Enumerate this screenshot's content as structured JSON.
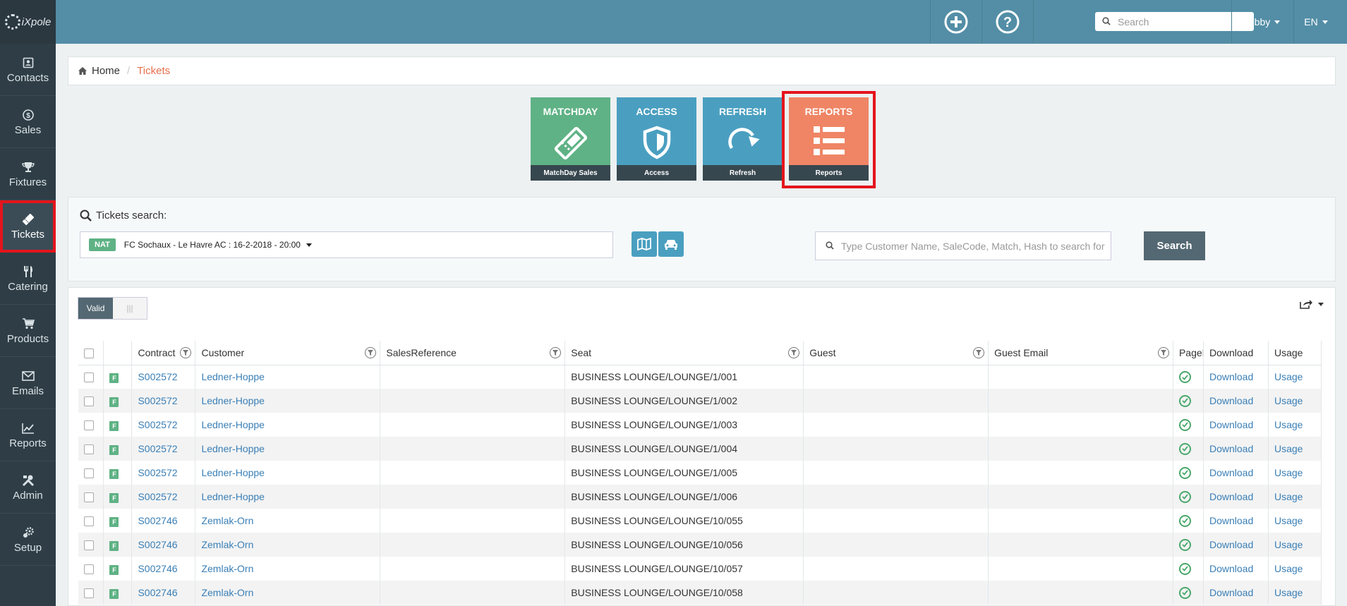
{
  "app": {
    "logo_text": "iXpole"
  },
  "sidebar": {
    "items": [
      {
        "label": "Contacts",
        "icon": "contacts-icon"
      },
      {
        "label": "Sales",
        "icon": "dollar-icon"
      },
      {
        "label": "Fixtures",
        "icon": "trophy-icon"
      },
      {
        "label": "Tickets",
        "icon": "ticket-icon",
        "active": true
      },
      {
        "label": "Catering",
        "icon": "cutlery-icon"
      },
      {
        "label": "Products",
        "icon": "cart-icon"
      },
      {
        "label": "Emails",
        "icon": "envelope-icon"
      },
      {
        "label": "Reports",
        "icon": "chart-icon"
      },
      {
        "label": "Admin",
        "icon": "tools-icon"
      },
      {
        "label": "Setup",
        "icon": "gears-icon"
      }
    ]
  },
  "topbar": {
    "search_placeholder": "Search",
    "user": "Robby",
    "lang": "EN"
  },
  "breadcrumb": {
    "home": "Home",
    "current": "Tickets"
  },
  "tiles": [
    {
      "title": "MATCHDAY",
      "footer": "MatchDay Sales",
      "color": "#5fb285",
      "icon": "ticket-icon"
    },
    {
      "title": "ACCESS",
      "footer": "Access",
      "color": "#4a9fc0",
      "icon": "shield-icon"
    },
    {
      "title": "REFRESH",
      "footer": "Refresh",
      "color": "#4a9fc0",
      "icon": "refresh-icon"
    },
    {
      "title": "REPORTS",
      "footer": "Reports",
      "color": "#ef8565",
      "icon": "list-icon"
    }
  ],
  "search_panel": {
    "title": "Tickets search:",
    "badge": "NAT",
    "selected_match": "FC Sochaux - Le Havre AC : 16-2-2018 - 20:00",
    "free_search_placeholder": "Type Customer Name, SaleCode, Match, Hash to search for",
    "search_button": "Search"
  },
  "table_panel": {
    "toggle_on": "Valid",
    "toggle_off": "|||",
    "columns": [
      "Contract",
      "Customer",
      "SalesReference",
      "Seat",
      "Guest",
      "Guest Email",
      "PageF",
      "Download",
      "Usage"
    ],
    "badge": "F",
    "rows": [
      {
        "contract": "S002572",
        "customer": "Ledner-Hoppe",
        "seat": "BUSINESS LOUNGE/LOUNGE/1/001",
        "download": "Download",
        "usage": "Usage"
      },
      {
        "contract": "S002572",
        "customer": "Ledner-Hoppe",
        "seat": "BUSINESS LOUNGE/LOUNGE/1/002",
        "download": "Download",
        "usage": "Usage"
      },
      {
        "contract": "S002572",
        "customer": "Ledner-Hoppe",
        "seat": "BUSINESS LOUNGE/LOUNGE/1/003",
        "download": "Download",
        "usage": "Usage"
      },
      {
        "contract": "S002572",
        "customer": "Ledner-Hoppe",
        "seat": "BUSINESS LOUNGE/LOUNGE/1/004",
        "download": "Download",
        "usage": "Usage"
      },
      {
        "contract": "S002572",
        "customer": "Ledner-Hoppe",
        "seat": "BUSINESS LOUNGE/LOUNGE/1/005",
        "download": "Download",
        "usage": "Usage"
      },
      {
        "contract": "S002572",
        "customer": "Ledner-Hoppe",
        "seat": "BUSINESS LOUNGE/LOUNGE/1/006",
        "download": "Download",
        "usage": "Usage"
      },
      {
        "contract": "S002746",
        "customer": "Zemlak-Orn",
        "seat": "BUSINESS LOUNGE/LOUNGE/10/055",
        "download": "Download",
        "usage": "Usage"
      },
      {
        "contract": "S002746",
        "customer": "Zemlak-Orn",
        "seat": "BUSINESS LOUNGE/LOUNGE/10/056",
        "download": "Download",
        "usage": "Usage"
      },
      {
        "contract": "S002746",
        "customer": "Zemlak-Orn",
        "seat": "BUSINESS LOUNGE/LOUNGE/10/057",
        "download": "Download",
        "usage": "Usage"
      },
      {
        "contract": "S002746",
        "customer": "Zemlak-Orn",
        "seat": "BUSINESS LOUNGE/LOUNGE/10/058",
        "download": "Download",
        "usage": "Usage"
      }
    ]
  }
}
